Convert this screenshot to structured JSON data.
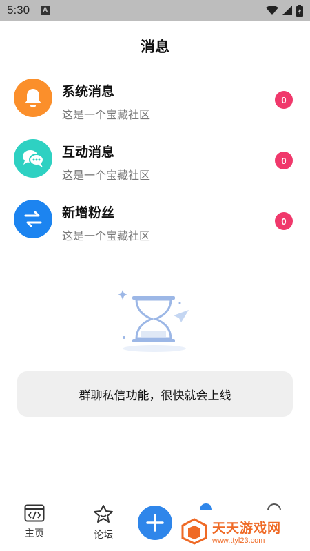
{
  "status_bar": {
    "time": "5:30",
    "notification_letter": "A"
  },
  "header": {
    "title": "消息"
  },
  "messages": [
    {
      "title": "系统消息",
      "subtitle": "这是一个宝藏社区",
      "badge": "0",
      "icon": "bell-icon",
      "color": "#fb8f2b"
    },
    {
      "title": "互动消息",
      "subtitle": "这是一个宝藏社区",
      "badge": "0",
      "icon": "chat-bubbles-icon",
      "color": "#2ed1c2"
    },
    {
      "title": "新增粉丝",
      "subtitle": "这是一个宝藏社区",
      "badge": "0",
      "icon": "swap-arrows-icon",
      "color": "#1c84f0"
    }
  ],
  "empty_state": {
    "illustration": "hourglass-icon",
    "notice": "群聊私信功能，很快就会上线"
  },
  "bottom_nav": {
    "items": [
      {
        "label": "主页",
        "icon": "code-window-icon"
      },
      {
        "label": "论坛",
        "icon": "star-face-icon"
      }
    ],
    "add_icon": "plus-icon"
  },
  "watermark": {
    "title": "天天游戏网",
    "url": "www.ttyl23.com"
  },
  "colors": {
    "badge": "#f0386b",
    "accent": "#2f86ea",
    "notice_bg": "#efefef"
  }
}
